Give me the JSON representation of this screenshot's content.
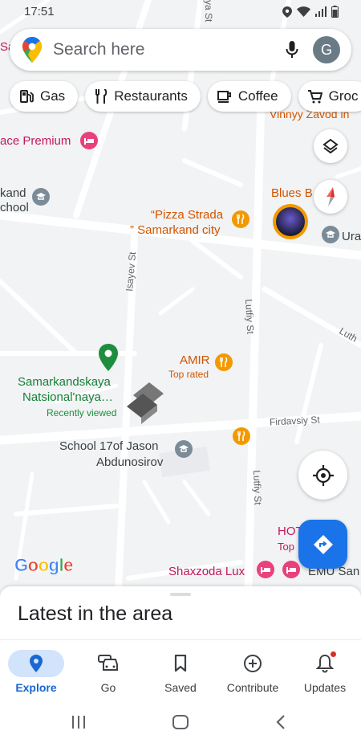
{
  "status_bar": {
    "time": "17:51"
  },
  "search": {
    "placeholder": "Search here",
    "avatar_letter": "G"
  },
  "chips": [
    {
      "label": "Gas",
      "icon": "gas-station-icon"
    },
    {
      "label": "Restaurants",
      "icon": "fork-knife-icon"
    },
    {
      "label": "Coffee",
      "icon": "coffee-cup-icon"
    },
    {
      "label": "Groc",
      "icon": "shopping-cart-icon"
    }
  ],
  "map": {
    "labels": {
      "vinnyy": "Vinnyy Zavod in",
      "palace": "ace Premium",
      "school_left_1": "kand",
      "school_left_2": "chool",
      "blues": "Blues B",
      "pizza_1": "“Pizza Strada",
      "pizza_2": "” Samarkand city",
      "ura": "Ura",
      "amir": "AMIR",
      "amir_sub": "Top rated",
      "samarkand_1": "Samarkandskaya",
      "samarkand_2": "Natsional'naya…",
      "samarkand_sub": "Recently viewed",
      "school17_1": "School 17of Jason",
      "school17_2": "Abdunosirov",
      "hotel": "HOTEL AH",
      "hotel_sub": "Top",
      "shaxzoda": "Shaxzoda Lux",
      "emu": "EMU San",
      "sa": "Sa"
    },
    "streets": {
      "isayev": "Isayev St",
      "lutfiy_upper": "Lutfiy St",
      "lutfiy_lower": "Lutfiy St",
      "firdavsiy": "Firdavsiy St",
      "luth": "Luth",
      "ya": "ya St"
    },
    "google_logo": "Google",
    "colors": {
      "blue": "#4285F4",
      "red": "#EA4335",
      "yellow": "#FBBC05",
      "green": "#34A853"
    }
  },
  "sheet": {
    "title": "Latest in the area"
  },
  "bottom_nav": [
    {
      "label": "Explore",
      "icon": "explore-pin-icon",
      "active": true
    },
    {
      "label": "Go",
      "icon": "car-icon",
      "active": false
    },
    {
      "label": "Saved",
      "icon": "bookmark-icon",
      "active": false
    },
    {
      "label": "Contribute",
      "icon": "plus-circle-icon",
      "active": false
    },
    {
      "label": "Updates",
      "icon": "bell-icon",
      "active": false
    }
  ],
  "accent_color": "#1a73e8"
}
